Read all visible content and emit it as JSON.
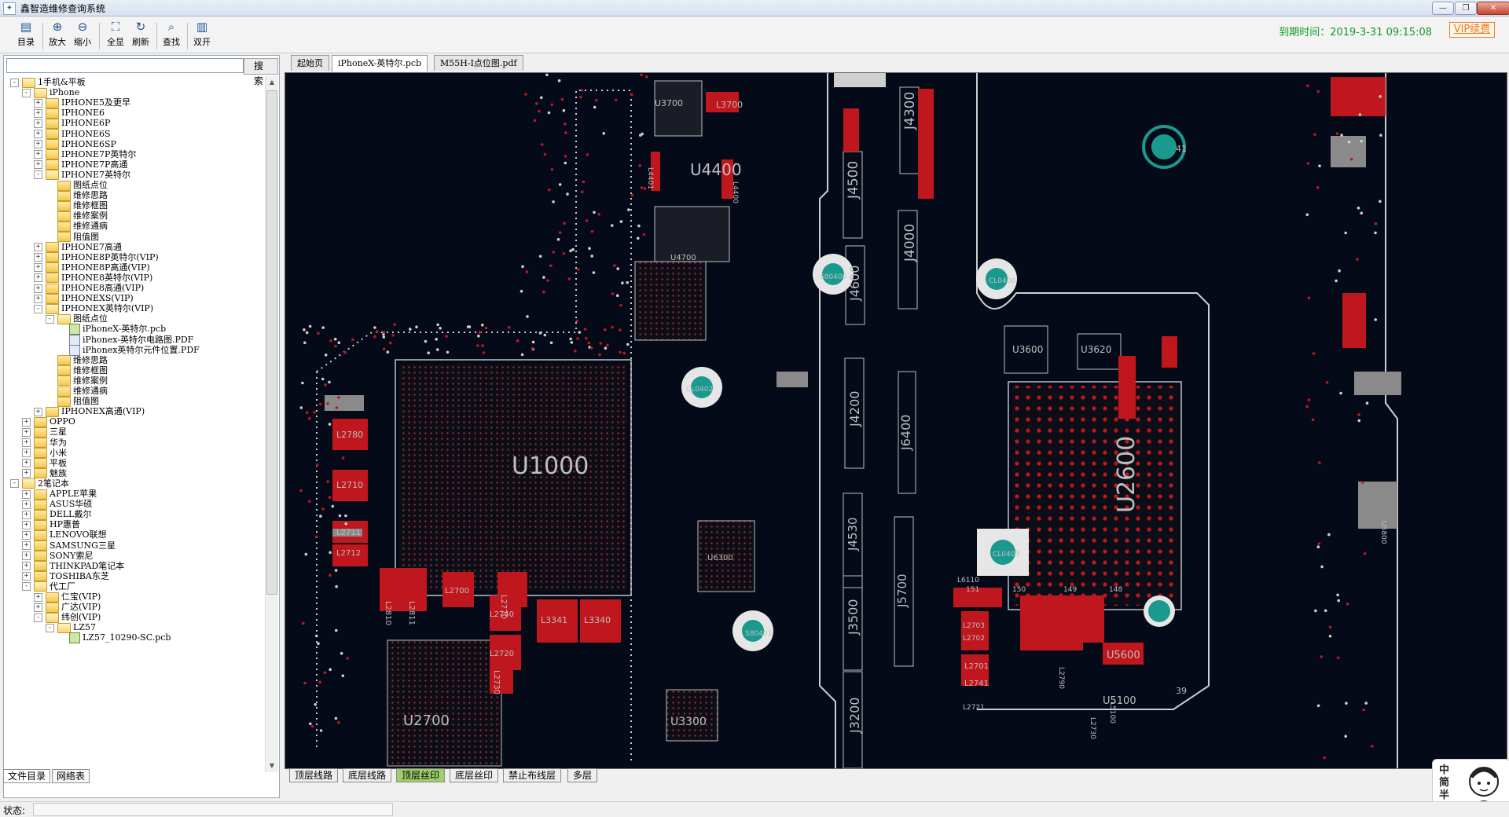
{
  "window": {
    "title": "鑫智造维修查询系统",
    "controls": [
      "—",
      "❐",
      "✕"
    ]
  },
  "toolbar": {
    "buttons": [
      {
        "label": "目录",
        "icon": "catalog-icon"
      },
      {
        "label": "放大",
        "icon": "zoom-in-icon"
      },
      {
        "label": "缩小",
        "icon": "zoom-out-icon"
      },
      {
        "label": "全显",
        "icon": "fit-all-icon"
      },
      {
        "label": "刷新",
        "icon": "refresh-icon"
      },
      {
        "label": "查找",
        "icon": "find-icon"
      },
      {
        "label": "双开",
        "icon": "dual-open-icon"
      }
    ],
    "expire_text": "到期时间：2019-3-31 09:15:08",
    "vip_button": "VIP续费"
  },
  "left_panel": {
    "search_value": "",
    "search_button": "搜 索",
    "tree": [
      {
        "label": "1手机&平板",
        "depth": 0,
        "toggle": "-",
        "icon": "folder-open"
      },
      {
        "label": "iPhone",
        "depth": 1,
        "toggle": "-",
        "icon": "folder-open"
      },
      {
        "label": "IPHONE5及更早",
        "depth": 2,
        "toggle": "+",
        "icon": "folder"
      },
      {
        "label": "IPHONE6",
        "depth": 2,
        "toggle": "+",
        "icon": "folder"
      },
      {
        "label": "IPHONE6P",
        "depth": 2,
        "toggle": "+",
        "icon": "folder"
      },
      {
        "label": "IPHONE6S",
        "depth": 2,
        "toggle": "+",
        "icon": "folder"
      },
      {
        "label": "IPHONE6SP",
        "depth": 2,
        "toggle": "+",
        "icon": "folder"
      },
      {
        "label": "IPHONE7P英特尔",
        "depth": 2,
        "toggle": "+",
        "icon": "folder"
      },
      {
        "label": "IPHONE7P高通",
        "depth": 2,
        "toggle": "+",
        "icon": "folder"
      },
      {
        "label": "IPHONE7英特尔",
        "depth": 2,
        "toggle": "-",
        "icon": "folder-open"
      },
      {
        "label": "图纸点位",
        "depth": 3,
        "toggle": "",
        "icon": "folder"
      },
      {
        "label": "维修思路",
        "depth": 3,
        "toggle": "",
        "icon": "folder"
      },
      {
        "label": "维修框图",
        "depth": 3,
        "toggle": "",
        "icon": "folder"
      },
      {
        "label": "维修案例",
        "depth": 3,
        "toggle": "",
        "icon": "folder"
      },
      {
        "label": "维修通病",
        "depth": 3,
        "toggle": "",
        "icon": "folder"
      },
      {
        "label": "阻值图",
        "depth": 3,
        "toggle": "",
        "icon": "folder"
      },
      {
        "label": "IPHONE7高通",
        "depth": 2,
        "toggle": "+",
        "icon": "folder"
      },
      {
        "label": "IPHONE8P英特尔(VIP)",
        "depth": 2,
        "toggle": "+",
        "icon": "folder"
      },
      {
        "label": "IPHONE8P高通(VIP)",
        "depth": 2,
        "toggle": "+",
        "icon": "folder"
      },
      {
        "label": "IPHONE8英特尔(VIP)",
        "depth": 2,
        "toggle": "+",
        "icon": "folder"
      },
      {
        "label": "IPHONE8高通(VIP)",
        "depth": 2,
        "toggle": "+",
        "icon": "folder"
      },
      {
        "label": "IPHONEXS(VIP)",
        "depth": 2,
        "toggle": "+",
        "icon": "folder"
      },
      {
        "label": "IPHONEX英特尔(VIP)",
        "depth": 2,
        "toggle": "-",
        "icon": "folder-open"
      },
      {
        "label": "图纸点位",
        "depth": 3,
        "toggle": "-",
        "icon": "folder-open"
      },
      {
        "label": "iPhoneX-英特尔.pcb",
        "depth": 4,
        "toggle": "",
        "icon": "file"
      },
      {
        "label": "iPhonex-英特尔电路图.PDF",
        "depth": 4,
        "toggle": "",
        "icon": "pdf"
      },
      {
        "label": "iPhonex英特尔元件位置.PDF",
        "depth": 4,
        "toggle": "",
        "icon": "pdf"
      },
      {
        "label": "维修思路",
        "depth": 3,
        "toggle": "",
        "icon": "folder"
      },
      {
        "label": "维修框图",
        "depth": 3,
        "toggle": "",
        "icon": "folder"
      },
      {
        "label": "维修案例",
        "depth": 3,
        "toggle": "",
        "icon": "folder"
      },
      {
        "label": "维修通病",
        "depth": 3,
        "toggle": "",
        "icon": "folder"
      },
      {
        "label": "阻值图",
        "depth": 3,
        "toggle": "",
        "icon": "folder"
      },
      {
        "label": "IPHONEX高通(VIP)",
        "depth": 2,
        "toggle": "+",
        "icon": "folder"
      },
      {
        "label": "OPPO",
        "depth": 1,
        "toggle": "+",
        "icon": "folder"
      },
      {
        "label": "三星",
        "depth": 1,
        "toggle": "+",
        "icon": "folder"
      },
      {
        "label": "华为",
        "depth": 1,
        "toggle": "+",
        "icon": "folder"
      },
      {
        "label": "小米",
        "depth": 1,
        "toggle": "+",
        "icon": "folder"
      },
      {
        "label": "平板",
        "depth": 1,
        "toggle": "+",
        "icon": "folder"
      },
      {
        "label": "魅族",
        "depth": 1,
        "toggle": "+",
        "icon": "folder"
      },
      {
        "label": "2笔记本",
        "depth": 0,
        "toggle": "-",
        "icon": "folder-open"
      },
      {
        "label": "APPLE苹果",
        "depth": 1,
        "toggle": "+",
        "icon": "folder"
      },
      {
        "label": "ASUS华硕",
        "depth": 1,
        "toggle": "+",
        "icon": "folder"
      },
      {
        "label": "DELL戴尔",
        "depth": 1,
        "toggle": "+",
        "icon": "folder"
      },
      {
        "label": "HP惠普",
        "depth": 1,
        "toggle": "+",
        "icon": "folder"
      },
      {
        "label": "LENOVO联想",
        "depth": 1,
        "toggle": "+",
        "icon": "folder"
      },
      {
        "label": "SAMSUNG三星",
        "depth": 1,
        "toggle": "+",
        "icon": "folder"
      },
      {
        "label": "SONY索尼",
        "depth": 1,
        "toggle": "+",
        "icon": "folder"
      },
      {
        "label": "THINKPAD笔记本",
        "depth": 1,
        "toggle": "+",
        "icon": "folder"
      },
      {
        "label": "TOSHIBA东芝",
        "depth": 1,
        "toggle": "+",
        "icon": "folder"
      },
      {
        "label": "代工厂",
        "depth": 1,
        "toggle": "-",
        "icon": "folder-open"
      },
      {
        "label": "仁宝(VIP)",
        "depth": 2,
        "toggle": "+",
        "icon": "folder"
      },
      {
        "label": "广达(VIP)",
        "depth": 2,
        "toggle": "+",
        "icon": "folder"
      },
      {
        "label": "纬创(VIP)",
        "depth": 2,
        "toggle": "-",
        "icon": "folder-open"
      },
      {
        "label": "LZ57",
        "depth": 3,
        "toggle": "-",
        "icon": "folder-open"
      },
      {
        "label": "LZ57_10290-SC.pcb",
        "depth": 4,
        "toggle": "",
        "icon": "file"
      }
    ],
    "bottom_tabs": [
      "文件目录",
      "网络表"
    ]
  },
  "doc_tabs": [
    "起始页",
    "iPhoneX-英特尔.pcb",
    "M55H-I点位图.pdf"
  ],
  "active_doc_tab": 1,
  "pcb": {
    "labels": [
      "U3700",
      "L3700",
      "U4400",
      "L4401",
      "L4400",
      "U4700",
      "U1000",
      "J4500",
      "J4300",
      "J4000",
      "J4600",
      "J4200",
      "J6400",
      "J4530",
      "J5700",
      "J3500",
      "J3200",
      "U3600",
      "U3620",
      "U2600",
      "L2780",
      "L2710",
      "L2711",
      "L2712",
      "L2810",
      "L2811",
      "L2700",
      "L2770",
      "L3341",
      "L3340",
      "L2740",
      "L2720",
      "L2730",
      "U2700",
      "U3300",
      "U6300",
      "L6110",
      "L2703",
      "L2702",
      "L2701",
      "L2741",
      "L2721",
      "L2790",
      "L2730",
      "L5100",
      "U5600",
      "U5100",
      "U5800",
      "151",
      "150",
      "149",
      "148",
      "41",
      "39",
      "S80400",
      "CL0400",
      "CL0402",
      "CL0403",
      "S80401"
    ],
    "colors": {
      "board": "#050a18",
      "copper": "#c0161d",
      "silk": "#bfbfbf",
      "via": "#1a9a8e",
      "outline": "#cfcfcf"
    }
  },
  "layer_tabs": [
    "顶层线路",
    "底层线路",
    "顶层丝印",
    "底层丝印",
    "禁止布线层",
    "多层"
  ],
  "active_layer_tab": 2,
  "status": {
    "label": "状态:"
  },
  "widget": {
    "text": [
      "中",
      "简",
      "半",
      "❤"
    ]
  }
}
